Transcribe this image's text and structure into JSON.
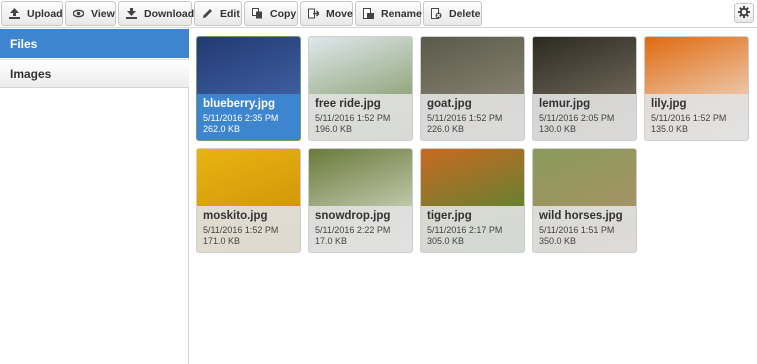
{
  "toolbar": {
    "buttons": [
      {
        "label": "Upload",
        "icon": "upload-icon"
      },
      {
        "label": "View",
        "icon": "eye-icon"
      },
      {
        "label": "Download",
        "icon": "download-icon"
      },
      {
        "label": "Edit",
        "icon": "pencil-icon"
      },
      {
        "label": "Copy",
        "icon": "copy-icon"
      },
      {
        "label": "Move",
        "icon": "move-icon"
      },
      {
        "label": "Rename",
        "icon": "rename-icon"
      },
      {
        "label": "Delete",
        "icon": "trash-icon"
      }
    ],
    "settings_icon": "gear-icon"
  },
  "sidebar": {
    "items": [
      {
        "label": "Files",
        "active": true
      },
      {
        "label": "Images",
        "active": false
      }
    ]
  },
  "files": [
    {
      "name": "blueberry.jpg",
      "date": "5/11/2016 2:35 PM",
      "size": "262.0 KB",
      "selected": true,
      "colors": [
        "#223a73",
        "#4b6fb4"
      ]
    },
    {
      "name": "free ride.jpg",
      "date": "5/11/2016 1:52 PM",
      "size": "196.0 KB",
      "selected": false,
      "colors": [
        "#dfe7ec",
        "#6e8a4a"
      ]
    },
    {
      "name": "goat.jpg",
      "date": "5/11/2016 1:52 PM",
      "size": "226.0 KB",
      "selected": false,
      "colors": [
        "#5a5a4a",
        "#9a9280"
      ]
    },
    {
      "name": "lemur.jpg",
      "date": "5/11/2016 2:05 PM",
      "size": "130.0 KB",
      "selected": false,
      "colors": [
        "#2c2a20",
        "#8a8070"
      ]
    },
    {
      "name": "lily.jpg",
      "date": "5/11/2016 1:52 PM",
      "size": "135.0 KB",
      "selected": false,
      "colors": [
        "#e06a10",
        "#f2f2f0"
      ]
    },
    {
      "name": "moskito.jpg",
      "date": "5/11/2016 1:52 PM",
      "size": "171.0 KB",
      "selected": false,
      "colors": [
        "#e8b410",
        "#c88a08"
      ]
    },
    {
      "name": "snowdrop.jpg",
      "date": "5/11/2016 2:22 PM",
      "size": "17.0 KB",
      "selected": false,
      "colors": [
        "#6a7a3a",
        "#e8ece0"
      ]
    },
    {
      "name": "tiger.jpg",
      "date": "5/11/2016 2:17 PM",
      "size": "305.0 KB",
      "selected": false,
      "colors": [
        "#c86a20",
        "#3a8a3a"
      ]
    },
    {
      "name": "wild horses.jpg",
      "date": "5/11/2016 1:51 PM",
      "size": "350.0 KB",
      "selected": false,
      "colors": [
        "#8a9a5a",
        "#b0906a"
      ]
    }
  ]
}
